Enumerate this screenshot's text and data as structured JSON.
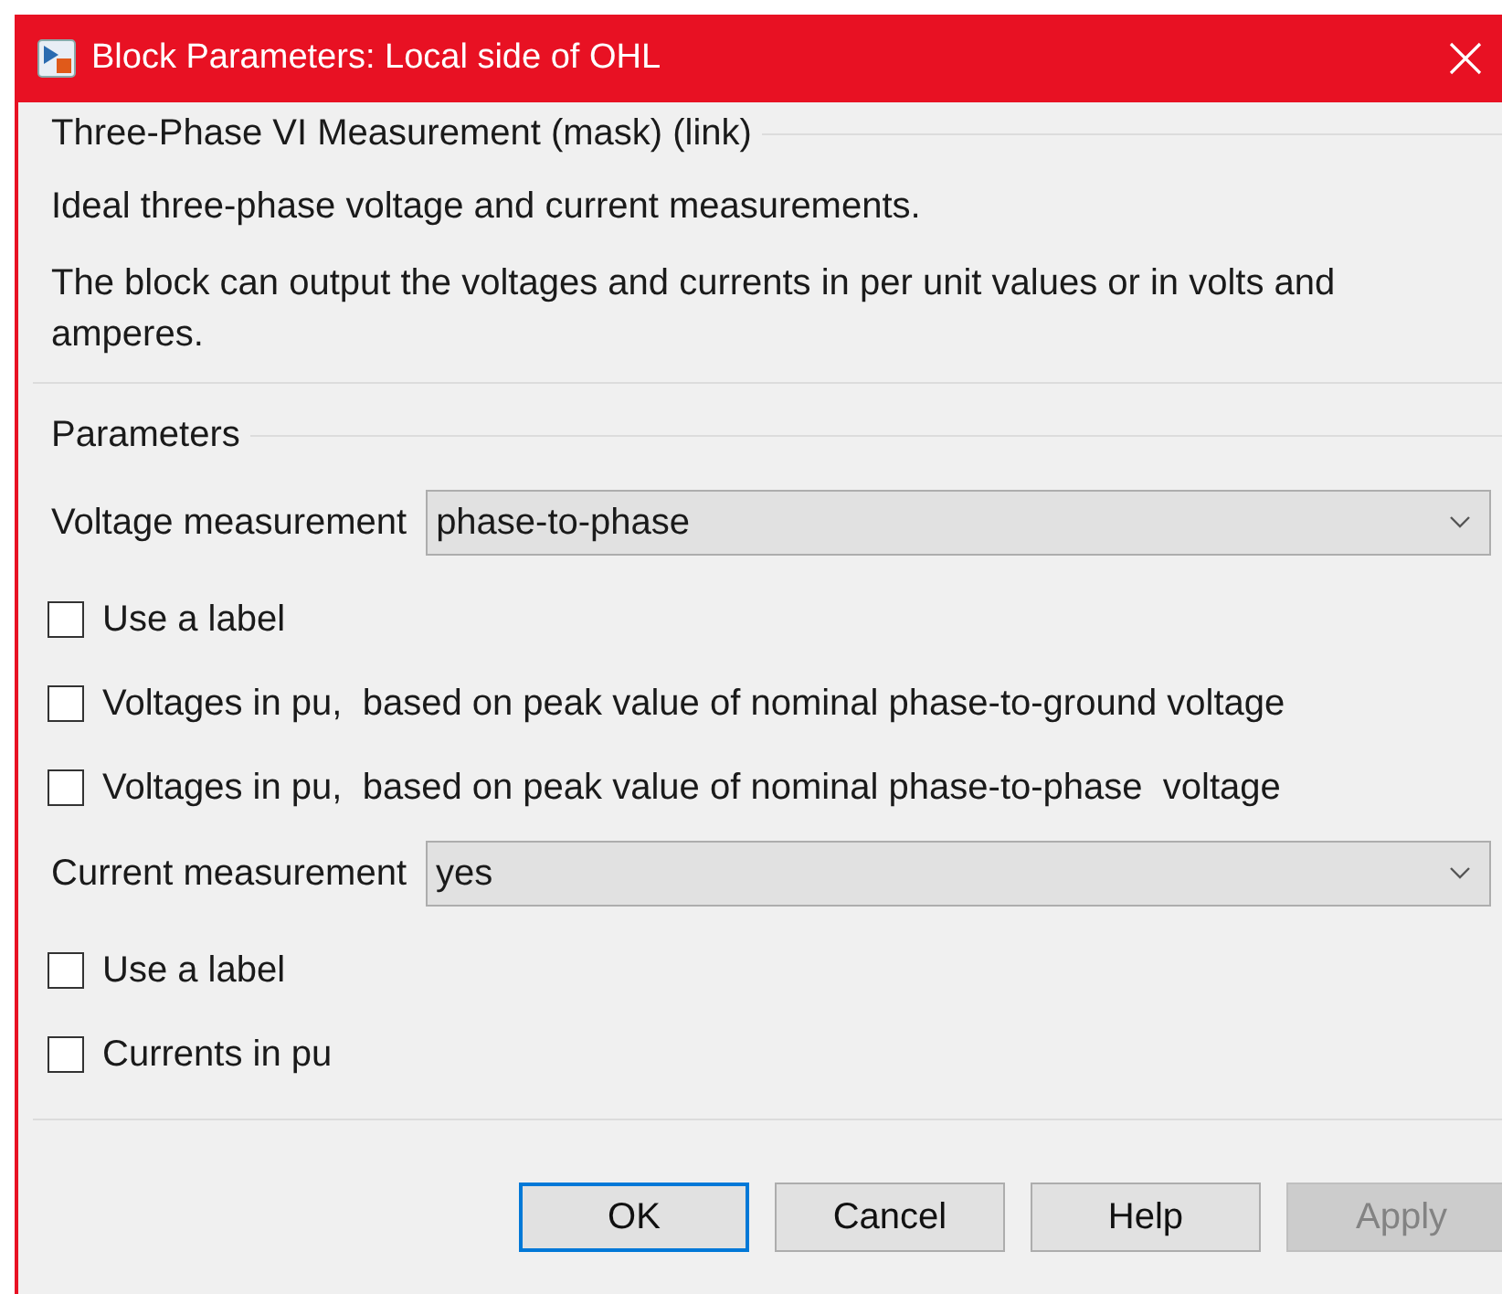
{
  "window": {
    "title": "Block Parameters: Local side of OHL"
  },
  "description": {
    "title": "Three-Phase VI Measurement (mask) (link)",
    "paragraphs": [
      "Ideal three-phase voltage and current measurements.",
      "The block can output the voltages and currents in per unit values or in volts and amperes."
    ]
  },
  "parameters": {
    "title": "Parameters",
    "items": [
      {
        "kind": "dropdown",
        "label": "Voltage measurement",
        "value": "phase-to-phase"
      },
      {
        "kind": "checkbox",
        "label": "Use a label",
        "checked": false
      },
      {
        "kind": "checkbox",
        "label": "Voltages in pu,  based on peak value of nominal phase-to-ground voltage",
        "checked": false
      },
      {
        "kind": "checkbox",
        "label": "Voltages in pu,  based on peak value of nominal phase-to-phase  voltage",
        "checked": false
      },
      {
        "kind": "dropdown",
        "label": "Current measurement",
        "value": "yes"
      },
      {
        "kind": "checkbox",
        "label": "Use a label",
        "checked": false
      },
      {
        "kind": "checkbox",
        "label": "Currents in pu",
        "checked": false
      }
    ]
  },
  "buttons": [
    {
      "label": "OK",
      "default": true,
      "disabled": false
    },
    {
      "label": "Cancel",
      "default": false,
      "disabled": false
    },
    {
      "label": "Help",
      "default": false,
      "disabled": false
    },
    {
      "label": "Apply",
      "default": false,
      "disabled": true
    }
  ]
}
